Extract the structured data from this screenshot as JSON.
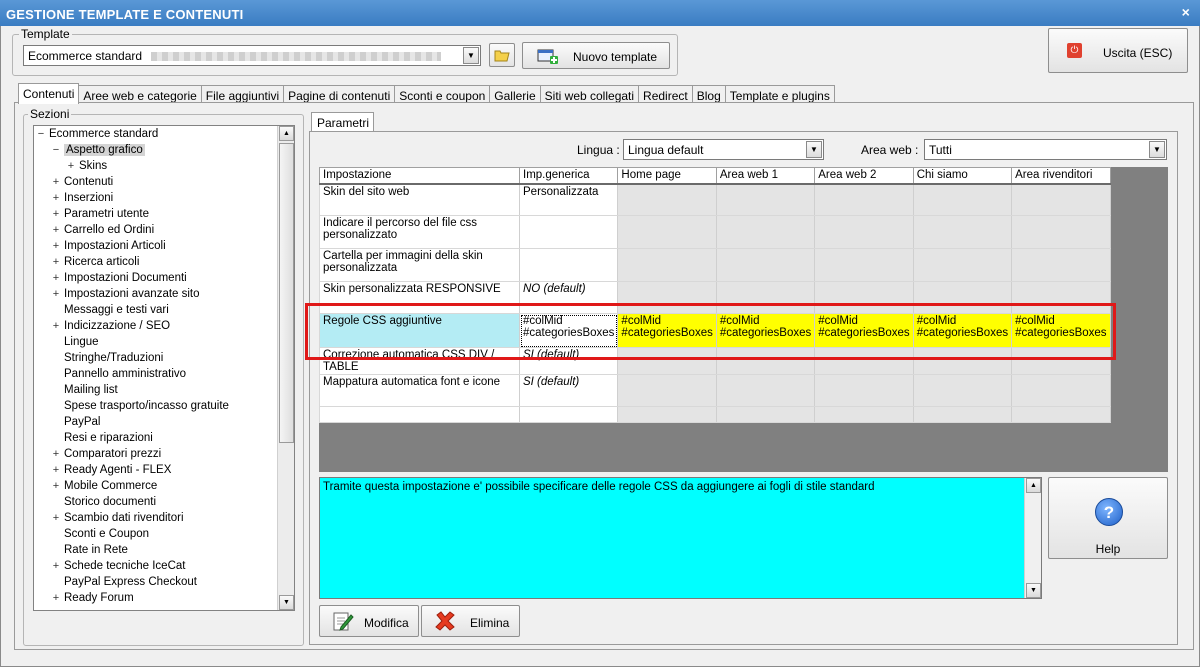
{
  "window": {
    "title": "GESTIONE TEMPLATE E CONTENUTI",
    "close_glyph": "×"
  },
  "template": {
    "legend": "Template",
    "selected": "Ecommerce standard",
    "new_button_label": "Nuovo template"
  },
  "exit_button_label": "Uscita (ESC)",
  "tabs": [
    "Contenuti",
    "Aree web e categorie",
    "File aggiuntivi",
    "Pagine di contenuti",
    "Sconti e coupon",
    "Gallerie",
    "Siti web collegati",
    "Redirect",
    "Blog",
    "Template e plugins"
  ],
  "sections": {
    "legend": "Sezioni",
    "items": [
      {
        "label": "Ecommerce standard",
        "level": 0,
        "toggle": "−"
      },
      {
        "label": "Aspetto grafico",
        "level": 1,
        "toggle": "−",
        "selected": true
      },
      {
        "label": "Skins",
        "level": 2,
        "toggle": "+"
      },
      {
        "label": "Contenuti",
        "level": 1,
        "toggle": "+"
      },
      {
        "label": "Inserzioni",
        "level": 1,
        "toggle": "+"
      },
      {
        "label": "Parametri utente",
        "level": 1,
        "toggle": "+"
      },
      {
        "label": "Carrello ed Ordini",
        "level": 1,
        "toggle": "+"
      },
      {
        "label": "Impostazioni Articoli",
        "level": 1,
        "toggle": "+"
      },
      {
        "label": "Ricerca articoli",
        "level": 1,
        "toggle": "+"
      },
      {
        "label": "Impostazioni Documenti",
        "level": 1,
        "toggle": "+"
      },
      {
        "label": "Impostazioni avanzate sito",
        "level": 1,
        "toggle": "+"
      },
      {
        "label": "Messaggi e testi vari",
        "level": 1,
        "toggle": ""
      },
      {
        "label": "Indicizzazione / SEO",
        "level": 1,
        "toggle": "+"
      },
      {
        "label": "Lingue",
        "level": 1,
        "toggle": ""
      },
      {
        "label": "Stringhe/Traduzioni",
        "level": 1,
        "toggle": ""
      },
      {
        "label": "Pannello amministrativo",
        "level": 1,
        "toggle": ""
      },
      {
        "label": "Mailing list",
        "level": 1,
        "toggle": ""
      },
      {
        "label": "Spese trasporto/incasso gratuite",
        "level": 1,
        "toggle": ""
      },
      {
        "label": "PayPal",
        "level": 1,
        "toggle": ""
      },
      {
        "label": "Resi e riparazioni",
        "level": 1,
        "toggle": ""
      },
      {
        "label": "Comparatori prezzi",
        "level": 1,
        "toggle": "+"
      },
      {
        "label": "Ready Agenti - FLEX",
        "level": 1,
        "toggle": "+"
      },
      {
        "label": "Mobile Commerce",
        "level": 1,
        "toggle": "+"
      },
      {
        "label": "Storico documenti",
        "level": 1,
        "toggle": ""
      },
      {
        "label": "Scambio dati rivenditori",
        "level": 1,
        "toggle": "+"
      },
      {
        "label": "Sconti e Coupon",
        "level": 1,
        "toggle": ""
      },
      {
        "label": "Rate in Rete",
        "level": 1,
        "toggle": ""
      },
      {
        "label": "Schede tecniche IceCat",
        "level": 1,
        "toggle": "+"
      },
      {
        "label": "PayPal Express Checkout",
        "level": 1,
        "toggle": ""
      },
      {
        "label": "Ready Forum",
        "level": 1,
        "toggle": "+"
      }
    ]
  },
  "params": {
    "tab_label": "Parametri",
    "lingua_label": "Lingua :",
    "lingua_value": "Lingua default",
    "area_label": "Area web :",
    "area_value": "Tutti"
  },
  "grid": {
    "headers": [
      "Impostazione",
      "Imp.generica",
      "Home page",
      "Area web 1",
      "Area web 2",
      "Chi siamo",
      "Area rivenditori"
    ],
    "rows": [
      {
        "label": "Skin del sito web",
        "generic": "Personalizzata",
        "others": [
          "",
          "",
          "",
          "",
          ""
        ]
      },
      {
        "label": "Indicare il percorso del file css personalizzato",
        "generic": "",
        "others": [
          "",
          "",
          "",
          "",
          ""
        ]
      },
      {
        "label": "Cartella per immagini della skin personalizzata",
        "generic": "",
        "others": [
          "",
          "",
          "",
          "",
          ""
        ]
      },
      {
        "label": "Skin personalizzata RESPONSIVE",
        "generic": "NO (default)",
        "others": [
          "",
          "",
          "",
          "",
          ""
        ]
      },
      {
        "label": "Regole CSS aggiuntive",
        "generic": "#colMid\n#categoriesBoxes",
        "others": [
          "#colMid\n#categoriesBoxes",
          "#colMid\n#categoriesBoxes",
          "#colMid\n#categoriesBoxes",
          "#colMid\n#categoriesBoxes",
          "#colMid\n#categoriesBoxes"
        ]
      },
      {
        "label": "Correzione automatica CSS DIV / TABLE",
        "generic": "SI (default)",
        "others": [
          "",
          "",
          "",
          "",
          ""
        ]
      },
      {
        "label": "Mappatura automatica font e icone",
        "generic": "SI (default)",
        "others": [
          "",
          "",
          "",
          "",
          ""
        ]
      },
      {
        "label": "",
        "generic": "",
        "others": [
          "",
          "",
          "",
          "",
          ""
        ]
      }
    ]
  },
  "description": "Tramite questa impostazione e' possibile specificare delle regole CSS da aggiungere ai fogli di stile standard",
  "help_label": "Help",
  "modifica_label": "Modifica",
  "elimina_label": "Elimina"
}
